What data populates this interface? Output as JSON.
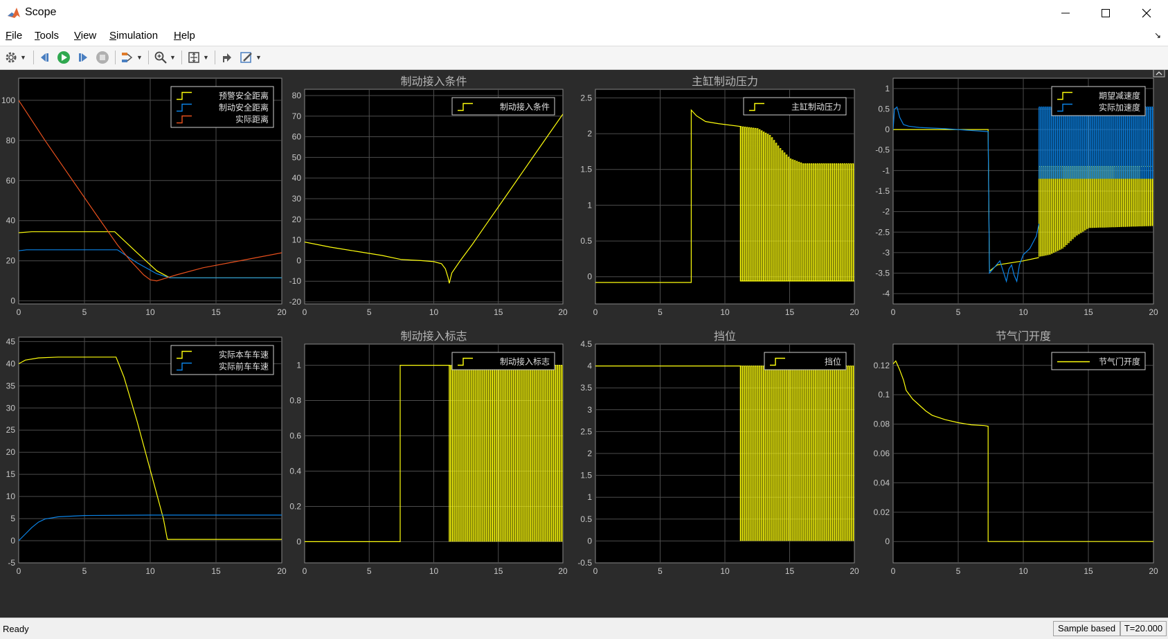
{
  "window": {
    "title": "Scope"
  },
  "menu": {
    "items": [
      "File",
      "Tools",
      "View",
      "Simulation",
      "Help"
    ]
  },
  "toolbar": {
    "buttons": [
      "settings-icon",
      "step-back-icon",
      "run-icon",
      "step-forward-icon",
      "stop-icon",
      "signal-selector-icon",
      "zoom-icon",
      "fit-axes-icon",
      "restore-layout-icon",
      "style-icon"
    ]
  },
  "status": {
    "ready": "Ready",
    "mode": "Sample based",
    "time": "T=20.000"
  },
  "colors": {
    "background": "#2b2b2b",
    "axes": "#000000",
    "grid": "#4d4d4d",
    "yellow": "#ffff0d",
    "blue": "#0b84e8",
    "orange": "#e8501d",
    "text": "#c8c8c8"
  },
  "chart_data": [
    {
      "type": "line",
      "title": "",
      "xlim": [
        0,
        20
      ],
      "ylim": [
        -1.5,
        111
      ],
      "xticks": [
        "0",
        "5",
        "10",
        "15",
        "20"
      ],
      "yticks": [
        "0",
        "20",
        "40",
        "60",
        "80",
        "100"
      ],
      "ytick_values": [
        0,
        20,
        40,
        60,
        80,
        100
      ],
      "legend": "top-right",
      "series": [
        {
          "name": "预警安全距离",
          "color": "yellow",
          "points": [
            [
              0,
              34
            ],
            [
              1,
              34.5
            ],
            [
              7.3,
              34.5
            ],
            [
              9,
              24
            ],
            [
              10.5,
              15
            ],
            [
              11.5,
              11.5
            ],
            [
              20,
              11.5
            ]
          ]
        },
        {
          "name": "制动安全距离",
          "color": "blue",
          "points": [
            [
              0,
              25
            ],
            [
              0.6,
              25.5
            ],
            [
              7.5,
              25.5
            ],
            [
              9,
              19
            ],
            [
              10.5,
              13.5
            ],
            [
              11.5,
              11.5
            ],
            [
              20,
              11.5
            ]
          ]
        },
        {
          "name": "实际距离",
          "color": "orange",
          "points": [
            [
              0,
              100
            ],
            [
              2,
              80
            ],
            [
              4,
              61
            ],
            [
              6,
              42
            ],
            [
              7.5,
              28
            ],
            [
              8.5,
              20
            ],
            [
              9.5,
              13
            ],
            [
              10,
              10.5
            ],
            [
              10.5,
              10
            ],
            [
              11,
              11
            ],
            [
              12,
              13
            ],
            [
              14,
              16.5
            ],
            [
              16,
              19
            ],
            [
              18,
              21.5
            ],
            [
              20,
              24
            ]
          ]
        }
      ]
    },
    {
      "type": "line",
      "title": "制动接入条件",
      "xlim": [
        0,
        20
      ],
      "ylim": [
        -21,
        83
      ],
      "xticks": [
        "0",
        "5",
        "10",
        "15",
        "20"
      ],
      "yticks": [
        "-20",
        "-10",
        "0",
        "10",
        "20",
        "30",
        "40",
        "50",
        "60",
        "70",
        "80"
      ],
      "ytick_values": [
        -20,
        -10,
        0,
        10,
        20,
        30,
        40,
        50,
        60,
        70,
        80
      ],
      "legend": "top-right",
      "series": [
        {
          "name": "制动接入条件",
          "color": "yellow",
          "points": [
            [
              0,
              9
            ],
            [
              2,
              6.5
            ],
            [
              4,
              4.5
            ],
            [
              6,
              2.5
            ],
            [
              7.5,
              0.5
            ],
            [
              9,
              0
            ],
            [
              10,
              -0.5
            ],
            [
              10.6,
              -1.5
            ],
            [
              10.9,
              -4
            ],
            [
              11.1,
              -8
            ],
            [
              11.2,
              -11
            ],
            [
              11.4,
              -6
            ],
            [
              12,
              -0.5
            ],
            [
              13,
              8
            ],
            [
              14,
              17
            ],
            [
              15,
              26
            ],
            [
              16,
              35
            ],
            [
              17,
              44
            ],
            [
              18,
              53
            ],
            [
              19,
              62
            ],
            [
              20,
              71
            ]
          ]
        }
      ]
    },
    {
      "type": "line",
      "title": "主缸制动压力",
      "xlim": [
        0,
        20
      ],
      "ylim": [
        -0.38,
        2.62
      ],
      "xticks": [
        "0",
        "5",
        "10",
        "15",
        "20"
      ],
      "yticks": [
        "0",
        "0.5",
        "1",
        "1.5",
        "2",
        "2.5"
      ],
      "ytick_values": [
        0,
        0.5,
        1,
        1.5,
        2,
        2.5
      ],
      "legend": "top-right",
      "series": [
        {
          "name": "主缸制动压力",
          "color": "yellow",
          "points": [
            [
              0,
              -0.08
            ],
            [
              7.4,
              -0.08
            ],
            [
              7.4,
              2.33
            ],
            [
              7.8,
              2.25
            ],
            [
              8.5,
              2.17
            ],
            [
              9.5,
              2.14
            ],
            [
              11.2,
              2.1
            ],
            [
              11.2,
              -0.06
            ],
            [
              20,
              -0.06
            ]
          ],
          "oscillation": {
            "from": 11.2,
            "to": 20,
            "low": -0.06,
            "high_points": [
              [
                11.2,
                2.1
              ],
              [
                12.5,
                2.07
              ],
              [
                13.5,
                1.97
              ],
              [
                14.2,
                1.8
              ],
              [
                15,
                1.65
              ],
              [
                16,
                1.58
              ],
              [
                20,
                1.58
              ]
            ]
          }
        }
      ]
    },
    {
      "type": "line",
      "title": "",
      "xlim": [
        0,
        20
      ],
      "ylim": [
        -4.25,
        1.25
      ],
      "xticks": [
        "0",
        "5",
        "10",
        "15",
        "20"
      ],
      "yticks": [
        "-4",
        "-3.5",
        "-3",
        "-2.5",
        "-2",
        "-1.5",
        "-1",
        "-0.5",
        "0",
        "0.5",
        "1"
      ],
      "ytick_values": [
        -4,
        -3.5,
        -3,
        -2.5,
        -2,
        -1.5,
        -1,
        -0.5,
        0,
        0.5,
        1
      ],
      "legend": "top-right",
      "series": [
        {
          "name": "期望减速度",
          "color": "yellow",
          "points": [
            [
              0,
              0
            ],
            [
              7.3,
              0
            ],
            [
              7.4,
              -3.45
            ],
            [
              8,
              -3.3
            ],
            [
              10,
              -3.2
            ],
            [
              11.2,
              -3.12
            ]
          ],
          "oscillation": {
            "from": 11.2,
            "to": 20,
            "low_points": [
              [
                11.2,
                -3.1
              ],
              [
                12,
                -3.05
              ],
              [
                13,
                -2.9
              ],
              [
                14,
                -2.6
              ],
              [
                15,
                -2.4
              ],
              [
                20,
                -2.35
              ]
            ],
            "high": -0.9
          }
        },
        {
          "name": "实际加速度",
          "color": "blue",
          "points": [
            [
              0,
              0
            ],
            [
              0.1,
              0.5
            ],
            [
              0.3,
              0.55
            ],
            [
              0.5,
              0.3
            ],
            [
              0.8,
              0.12
            ],
            [
              1.2,
              0.08
            ],
            [
              2,
              0.05
            ],
            [
              4,
              0.02
            ],
            [
              7.3,
              -0.05
            ],
            [
              7.4,
              -3.5
            ],
            [
              7.8,
              -3.35
            ],
            [
              8.2,
              -3.2
            ],
            [
              8.5,
              -3.5
            ],
            [
              8.7,
              -3.7
            ],
            [
              8.9,
              -3.4
            ],
            [
              9.1,
              -3.3
            ],
            [
              9.3,
              -3.55
            ],
            [
              9.5,
              -3.7
            ],
            [
              9.7,
              -3.3
            ],
            [
              10,
              -3.05
            ],
            [
              10.5,
              -2.9
            ],
            [
              11,
              -2.6
            ],
            [
              11.2,
              -2.3
            ]
          ],
          "oscillation": {
            "from": 11.2,
            "to": 20,
            "low": -1.2,
            "high": 0.55
          }
        }
      ]
    },
    {
      "type": "line",
      "title": "",
      "xlim": [
        0,
        20
      ],
      "ylim": [
        -5,
        46
      ],
      "xticks": [
        "0",
        "5",
        "10",
        "15",
        "20"
      ],
      "yticks": [
        "-5",
        "0",
        "5",
        "10",
        "15",
        "20",
        "25",
        "30",
        "35",
        "40",
        "45"
      ],
      "ytick_values": [
        -5,
        0,
        5,
        10,
        15,
        20,
        25,
        30,
        35,
        40,
        45
      ],
      "legend": "top-right",
      "series": [
        {
          "name": "实际本车车速",
          "color": "yellow",
          "points": [
            [
              0,
              40
            ],
            [
              0.5,
              40.8
            ],
            [
              1.5,
              41.3
            ],
            [
              3,
              41.5
            ],
            [
              7.4,
              41.5
            ],
            [
              8,
              37
            ],
            [
              9,
              27
            ],
            [
              10,
              16
            ],
            [
              11,
              5
            ],
            [
              11.3,
              0.3
            ],
            [
              20,
              0.3
            ]
          ]
        },
        {
          "name": "实际前车车速",
          "color": "blue",
          "points": [
            [
              0,
              0
            ],
            [
              0.5,
              1.5
            ],
            [
              1,
              3
            ],
            [
              1.5,
              4.2
            ],
            [
              2,
              4.9
            ],
            [
              3,
              5.4
            ],
            [
              5,
              5.7
            ],
            [
              10,
              5.8
            ],
            [
              20,
              5.8
            ]
          ]
        }
      ]
    },
    {
      "type": "line",
      "title": "制动接入标志",
      "xlim": [
        0,
        20
      ],
      "ylim": [
        -0.12,
        1.12
      ],
      "xticks": [
        "0",
        "5",
        "10",
        "15",
        "20"
      ],
      "yticks": [
        "0",
        "0.2",
        "0.4",
        "0.6",
        "0.8",
        "1"
      ],
      "ytick_values": [
        0,
        0.2,
        0.4,
        0.6,
        0.8,
        1
      ],
      "legend": "top-right",
      "series": [
        {
          "name": "制动接入标志",
          "color": "yellow",
          "points": [
            [
              0,
              0
            ],
            [
              7.4,
              0
            ],
            [
              7.4,
              1
            ],
            [
              11.2,
              1
            ],
            [
              11.2,
              0
            ]
          ],
          "oscillation": {
            "from": 11.2,
            "to": 20,
            "low": 0,
            "high": 1
          }
        }
      ]
    },
    {
      "type": "line",
      "title": "挡位",
      "xlim": [
        0,
        20
      ],
      "ylim": [
        -0.5,
        4.5
      ],
      "xticks": [
        "0",
        "5",
        "10",
        "15",
        "20"
      ],
      "yticks": [
        "-0.5",
        "0",
        "0.5",
        "1",
        "1.5",
        "2",
        "2.5",
        "3",
        "3.5",
        "4",
        "4.5"
      ],
      "ytick_values": [
        -0.5,
        0,
        0.5,
        1,
        1.5,
        2,
        2.5,
        3,
        3.5,
        4,
        4.5
      ],
      "legend": "top-right",
      "series": [
        {
          "name": "挡位",
          "color": "yellow",
          "points": [
            [
              0,
              4
            ],
            [
              11.2,
              4
            ],
            [
              11.2,
              0
            ]
          ],
          "oscillation": {
            "from": 11.2,
            "to": 20,
            "low": 0,
            "high": 4
          }
        }
      ]
    },
    {
      "type": "line",
      "title": "节气门开度",
      "xlim": [
        0,
        20
      ],
      "ylim": [
        -0.0145,
        0.1345
      ],
      "xticks": [
        "0",
        "5",
        "10",
        "15",
        "20"
      ],
      "yticks": [
        "0",
        "0.02",
        "0.04",
        "0.06",
        "0.08",
        "0.1",
        "0.12"
      ],
      "ytick_values": [
        0,
        0.02,
        0.04,
        0.06,
        0.08,
        0.1,
        0.12
      ],
      "legend": "top-right",
      "series": [
        {
          "name": "节气门开度",
          "color": "yellow",
          "points": [
            [
              0,
              0.121
            ],
            [
              0.2,
              0.123
            ],
            [
              0.5,
              0.117
            ],
            [
              0.8,
              0.11
            ],
            [
              1,
              0.103
            ],
            [
              1.5,
              0.097
            ],
            [
              2,
              0.093
            ],
            [
              2.5,
              0.089
            ],
            [
              3,
              0.086
            ],
            [
              4,
              0.083
            ],
            [
              5,
              0.081
            ],
            [
              6,
              0.0795
            ],
            [
              7,
              0.079
            ],
            [
              7.3,
              0.0785
            ],
            [
              7.3,
              0
            ],
            [
              20,
              0
            ]
          ]
        }
      ]
    }
  ]
}
